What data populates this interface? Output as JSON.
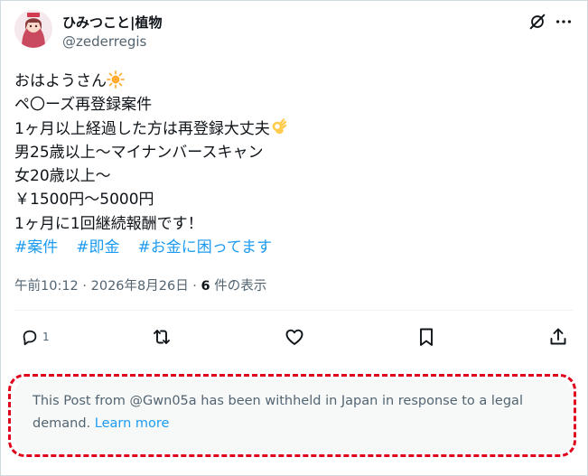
{
  "author": {
    "display_name": "ひみつこと|植物",
    "handle": "@zederregis",
    "avatar_icon": "anime-avatar"
  },
  "header_icons": [
    "grok-icon",
    "more-icon"
  ],
  "post": {
    "lines": [
      "ペ〇ーズ再登録案件",
      "1ヶ月以上経過した方は再登録大丈夫",
      "男25歳以上〜マイナンバースキャン",
      "女20歳以上〜",
      "￥1500円〜5000円",
      "1ヶ月に1回継続報酬です！"
    ],
    "greeting": "おはようさん",
    "greeting_emoji": "sun-emoji",
    "ok_emoji": "ok-hand-emoji",
    "hashtags": [
      "#案件",
      "#即金",
      "#お金に困ってます"
    ]
  },
  "meta": {
    "time_date": "午前10:12 · 2026年8月26日 · ",
    "views_count": "6",
    "views_label": " 件の表示"
  },
  "actions": {
    "reply_count": "1",
    "icons": [
      "reply-icon",
      "retweet-icon",
      "like-icon",
      "bookmark-icon",
      "share-icon"
    ]
  },
  "notice": {
    "text": "This Post from @Gwn05a has been withheld in Japan in response to a legal demand. ",
    "link": "Learn more"
  },
  "colors": {
    "accent": "#1d9bf0",
    "secondary_text": "#536471",
    "highlight_border": "#e0001b",
    "notice_bg": "#f7f9f9"
  }
}
